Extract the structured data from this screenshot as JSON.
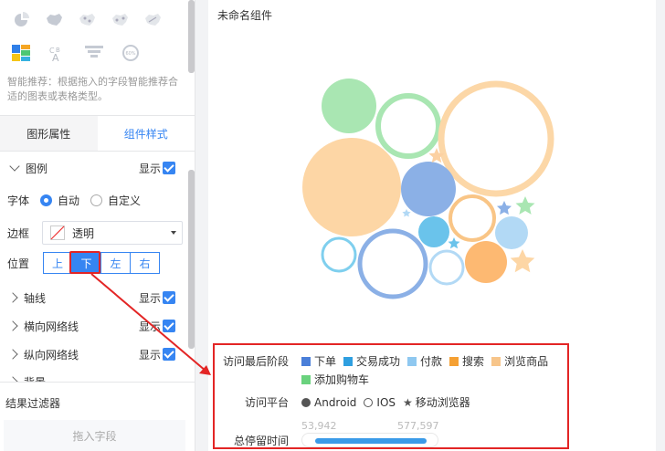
{
  "sidebar": {
    "chart_icons_row1": [
      "pie-map-icon",
      "china-map-icon",
      "dot-map-icon",
      "dot-map-2-icon",
      "dot-map-3-icon"
    ],
    "chart_icons_row2": [
      "color-block-icon",
      "text-chart-icon",
      "funnel-icon",
      "gauge-icon"
    ],
    "gauge_icon_text": "60%",
    "recommend_text": "智能推荐：根据拖入的字段智能推荐合适的图表或表格类型。",
    "tabs": [
      "图形属性",
      "组件样式"
    ],
    "legend_section": {
      "label": "图例",
      "show_label": "显示"
    },
    "font_row": {
      "label": "字体",
      "options": [
        "自动",
        "自定义"
      ],
      "selected": "自动"
    },
    "border_row": {
      "label": "边框",
      "value": "透明"
    },
    "position_row": {
      "label": "位置",
      "options": [
        "上",
        "下",
        "左",
        "右"
      ],
      "selected": "下"
    },
    "sections": [
      {
        "label": "轴线",
        "show_label": "显示"
      },
      {
        "label": "横向网络线",
        "show_label": "显示"
      },
      {
        "label": "纵向网络线",
        "show_label": "显示"
      },
      {
        "label": "背景"
      }
    ],
    "filter": {
      "title": "结果过滤器",
      "drop_placeholder": "拖入字段"
    }
  },
  "canvas": {
    "title": "未命名组件",
    "legend": {
      "stage": {
        "label": "访问最后阶段",
        "items": [
          {
            "name": "下单",
            "color": "#4a7fd9"
          },
          {
            "name": "交易成功",
            "color": "#2f9fe0"
          },
          {
            "name": "付款",
            "color": "#8fc8f0"
          },
          {
            "name": "搜索",
            "color": "#f5a033"
          },
          {
            "name": "浏览商品",
            "color": "#f7c58a"
          },
          {
            "name": "添加购物车",
            "color": "#6ad27e"
          }
        ]
      },
      "platform": {
        "label": "访问平台",
        "items": [
          {
            "name": "Android",
            "shape": "filled-circle"
          },
          {
            "name": "IOS",
            "shape": "hollow-circle"
          },
          {
            "name": "移动浏览器",
            "shape": "star"
          }
        ]
      },
      "duration": {
        "label": "总停留时间",
        "min": "53,942",
        "max": "577,597"
      }
    }
  },
  "colors": {
    "accent": "#3685f2",
    "highlight": "#e32525"
  }
}
